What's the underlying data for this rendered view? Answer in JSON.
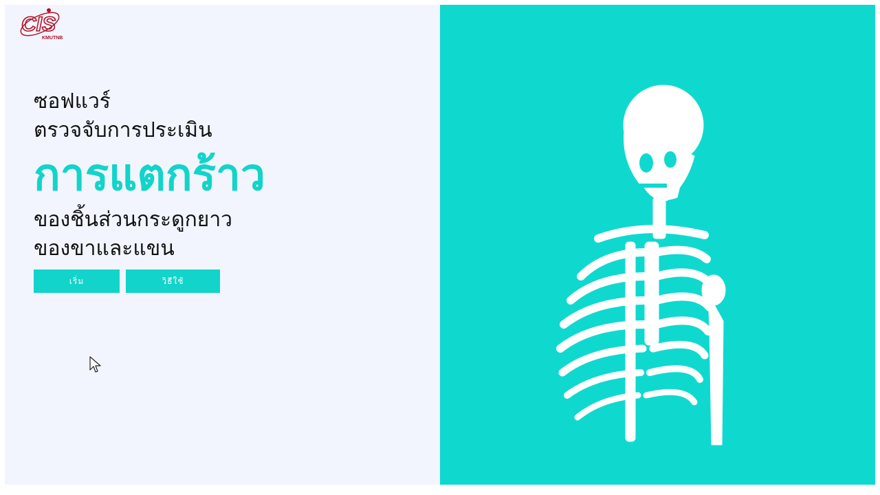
{
  "logo": {
    "text": "CIS",
    "subtext": "KMUTNB"
  },
  "hero": {
    "line1": "ซอฟแวร์",
    "line2": "ตรวจจับการประเมิน",
    "highlight": "การแตกร้าว",
    "line3": "ของชิ้นส่วนกระดูกยาว",
    "line4": "ของขาและแขน"
  },
  "buttons": {
    "start_label": "เริ่ม",
    "howto_label": "วิธีใช้"
  },
  "colors": {
    "accent": "#12d4ca",
    "panel_bg": "#0fd9cf",
    "left_bg": "#f2f5fd",
    "logo_red": "#b3122a"
  },
  "illustration": {
    "icon": "skeleton-illustration"
  }
}
